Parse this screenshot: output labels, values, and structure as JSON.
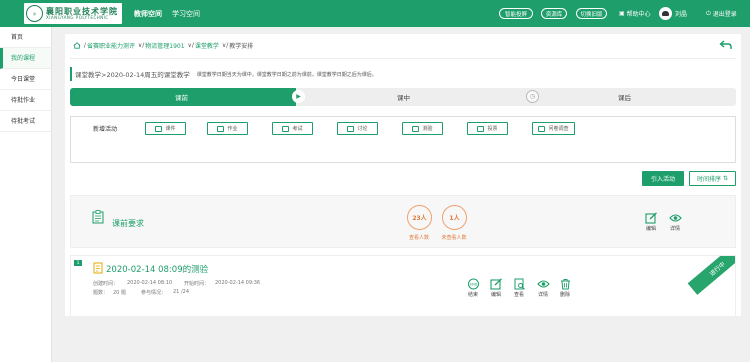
{
  "header": {
    "logo_cn": "襄阳职业技术学院",
    "logo_en": "XIANGYANG POLYTECHNIC",
    "tabs": [
      {
        "label": "教师空间"
      },
      {
        "label": "学习空间"
      }
    ],
    "buttons": [
      {
        "label": "智能投屏"
      },
      {
        "label": "资源库"
      },
      {
        "label": "切换旧版"
      }
    ],
    "help_label": "帮助中心",
    "user_name": "刘晶",
    "logout_label": "退出登录"
  },
  "sidebar": {
    "items": [
      {
        "label": "首页"
      },
      {
        "label": "我的课程"
      },
      {
        "label": "今日课堂"
      },
      {
        "label": "待批作业"
      },
      {
        "label": "待批考试"
      }
    ]
  },
  "breadcrumb": {
    "items": [
      "省赛职业能力测评",
      "物流管理1901",
      "课堂教学"
    ],
    "current": "教学安排"
  },
  "lesson": {
    "title": "课堂教学>2020-02-14周五的课堂教学",
    "tip": "课堂教学日期当天为课中，课堂教学日期之前为课前，课堂教学日期之后为课后。"
  },
  "stages": [
    {
      "label": "课前"
    },
    {
      "label": "课中"
    },
    {
      "label": "课后"
    }
  ],
  "stage_progress_pct": 34,
  "activities": {
    "label": "新增活动",
    "items": [
      {
        "label": "课件"
      },
      {
        "label": "作业"
      },
      {
        "label": "考试"
      },
      {
        "label": "讨论"
      },
      {
        "label": "测验"
      },
      {
        "label": "投票"
      },
      {
        "label": "问卷调查"
      }
    ]
  },
  "actions": {
    "import_label": "引入活动",
    "sort_label": "时间排序"
  },
  "requirements": {
    "title": "课前要求",
    "viewed_count": "23人",
    "viewed_caption": "查看人数",
    "not_viewed_count": "1人",
    "not_viewed_caption": "未查看人数",
    "edit_label": "编辑",
    "detail_label": "详情"
  },
  "quiz": {
    "index": "1",
    "title": "2020-02-14 08:09的测验",
    "created_label": "创建时间：",
    "created_value": "2020-02-14 08:10",
    "start_label": "开始时间：",
    "start_value": "2020-02-14 09:36",
    "questions_label": "题数：",
    "questions_value": "20 题",
    "participation_label": "参与情况：",
    "participation_value": "21 /24",
    "status": "进行中",
    "action_labels": [
      {
        "label": "结束"
      },
      {
        "label": "编辑"
      },
      {
        "label": "查看"
      },
      {
        "label": "详情"
      },
      {
        "label": "删除"
      }
    ]
  },
  "colors": {
    "accent": "#1e9e6a",
    "orange": "#e07a3a"
  }
}
